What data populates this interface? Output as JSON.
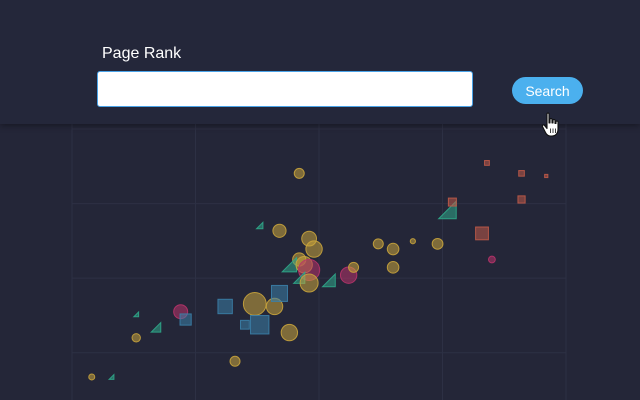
{
  "header": {
    "label": "Page Rank",
    "search_value": "",
    "search_placeholder": "",
    "button_label": "Search"
  },
  "chart_data": {
    "type": "scatter",
    "grid": true,
    "title": "",
    "xlabel": "",
    "ylabel": "",
    "xlim": [
      0,
      100
    ],
    "ylim": [
      0,
      100
    ],
    "colors": {
      "circle": "#c9a43c",
      "circle_alt": "#b8336a",
      "square": "#3b7fa8",
      "square_alt": "#c05a48",
      "triangle": "#2fa88a"
    },
    "points": [
      {
        "shape": "circle",
        "color": "circle",
        "x": 4,
        "y": 5,
        "r": 0.5
      },
      {
        "shape": "triangle",
        "color": "triangle",
        "x": 8,
        "y": 5,
        "r": 0.6
      },
      {
        "shape": "circle",
        "color": "circle",
        "x": 13,
        "y": 20,
        "r": 0.8
      },
      {
        "shape": "triangle",
        "color": "triangle",
        "x": 13,
        "y": 29,
        "r": 0.6
      },
      {
        "shape": "triangle",
        "color": "triangle",
        "x": 17,
        "y": 24,
        "r": 1.2
      },
      {
        "shape": "circle",
        "color": "circle_alt",
        "x": 22,
        "y": 30,
        "r": 1.5
      },
      {
        "shape": "square",
        "color": "square",
        "x": 23,
        "y": 27,
        "r": 1.4
      },
      {
        "shape": "square",
        "color": "square",
        "x": 31,
        "y": 32,
        "r": 1.8
      },
      {
        "shape": "circle",
        "color": "circle",
        "x": 33,
        "y": 11,
        "r": 1.0
      },
      {
        "shape": "circle",
        "color": "circle",
        "x": 37,
        "y": 33,
        "r": 2.6
      },
      {
        "shape": "square",
        "color": "square",
        "x": 35,
        "y": 25,
        "r": 1.1
      },
      {
        "shape": "square",
        "color": "square",
        "x": 38,
        "y": 25,
        "r": 2.3
      },
      {
        "shape": "circle",
        "color": "circle",
        "x": 41,
        "y": 32,
        "r": 1.8
      },
      {
        "shape": "square",
        "color": "square",
        "x": 42,
        "y": 37,
        "r": 2.0
      },
      {
        "shape": "circle",
        "color": "circle",
        "x": 44,
        "y": 22,
        "r": 1.8
      },
      {
        "shape": "triangle",
        "color": "triangle",
        "x": 38,
        "y": 63,
        "r": 0.8
      },
      {
        "shape": "circle",
        "color": "circle",
        "x": 42,
        "y": 61,
        "r": 1.4
      },
      {
        "shape": "circle",
        "color": "circle",
        "x": 46,
        "y": 83,
        "r": 1.0
      },
      {
        "shape": "circle",
        "color": "circle",
        "x": 46,
        "y": 50,
        "r": 1.4
      },
      {
        "shape": "triangle",
        "color": "triangle",
        "x": 44,
        "y": 48,
        "r": 1.8
      },
      {
        "shape": "circle",
        "color": "circle",
        "x": 47,
        "y": 48,
        "r": 1.8
      },
      {
        "shape": "circle",
        "color": "circle_alt",
        "x": 48,
        "y": 46,
        "r": 2.4
      },
      {
        "shape": "triangle",
        "color": "triangle",
        "x": 46,
        "y": 43,
        "r": 1.4
      },
      {
        "shape": "circle",
        "color": "circle",
        "x": 48,
        "y": 58,
        "r": 1.6
      },
      {
        "shape": "circle",
        "color": "circle",
        "x": 49,
        "y": 54,
        "r": 1.8
      },
      {
        "shape": "circle",
        "color": "circle",
        "x": 48,
        "y": 41,
        "r": 2.0
      },
      {
        "shape": "triangle",
        "color": "triangle",
        "x": 52,
        "y": 42,
        "r": 1.6
      },
      {
        "shape": "circle",
        "color": "circle_alt",
        "x": 56,
        "y": 44,
        "r": 1.8
      },
      {
        "shape": "circle",
        "color": "circle",
        "x": 57,
        "y": 47,
        "r": 1.0
      },
      {
        "shape": "circle",
        "color": "circle",
        "x": 62,
        "y": 56,
        "r": 1.0
      },
      {
        "shape": "circle",
        "color": "circle",
        "x": 65,
        "y": 54,
        "r": 1.2
      },
      {
        "shape": "circle",
        "color": "circle",
        "x": 65,
        "y": 47,
        "r": 1.2
      },
      {
        "shape": "circle",
        "color": "circle",
        "x": 69,
        "y": 57,
        "r": 0.4
      },
      {
        "shape": "circle",
        "color": "circle",
        "x": 74,
        "y": 56,
        "r": 1.1
      },
      {
        "shape": "triangle",
        "color": "triangle",
        "x": 76,
        "y": 69,
        "r": 2.2
      },
      {
        "shape": "square",
        "color": "square_alt",
        "x": 77,
        "y": 72,
        "r": 1.0
      },
      {
        "shape": "square",
        "color": "square_alt",
        "x": 83,
        "y": 60,
        "r": 1.6
      },
      {
        "shape": "square",
        "color": "square_alt",
        "x": 84,
        "y": 87,
        "r": 0.6
      },
      {
        "shape": "circle",
        "color": "circle_alt",
        "x": 85,
        "y": 50,
        "r": 0.6
      },
      {
        "shape": "square",
        "color": "square_alt",
        "x": 91,
        "y": 83,
        "r": 0.7
      },
      {
        "shape": "square",
        "color": "square_alt",
        "x": 91,
        "y": 73,
        "r": 0.9
      },
      {
        "shape": "square",
        "color": "square_alt",
        "x": 96,
        "y": 82,
        "r": 0.4
      }
    ]
  }
}
